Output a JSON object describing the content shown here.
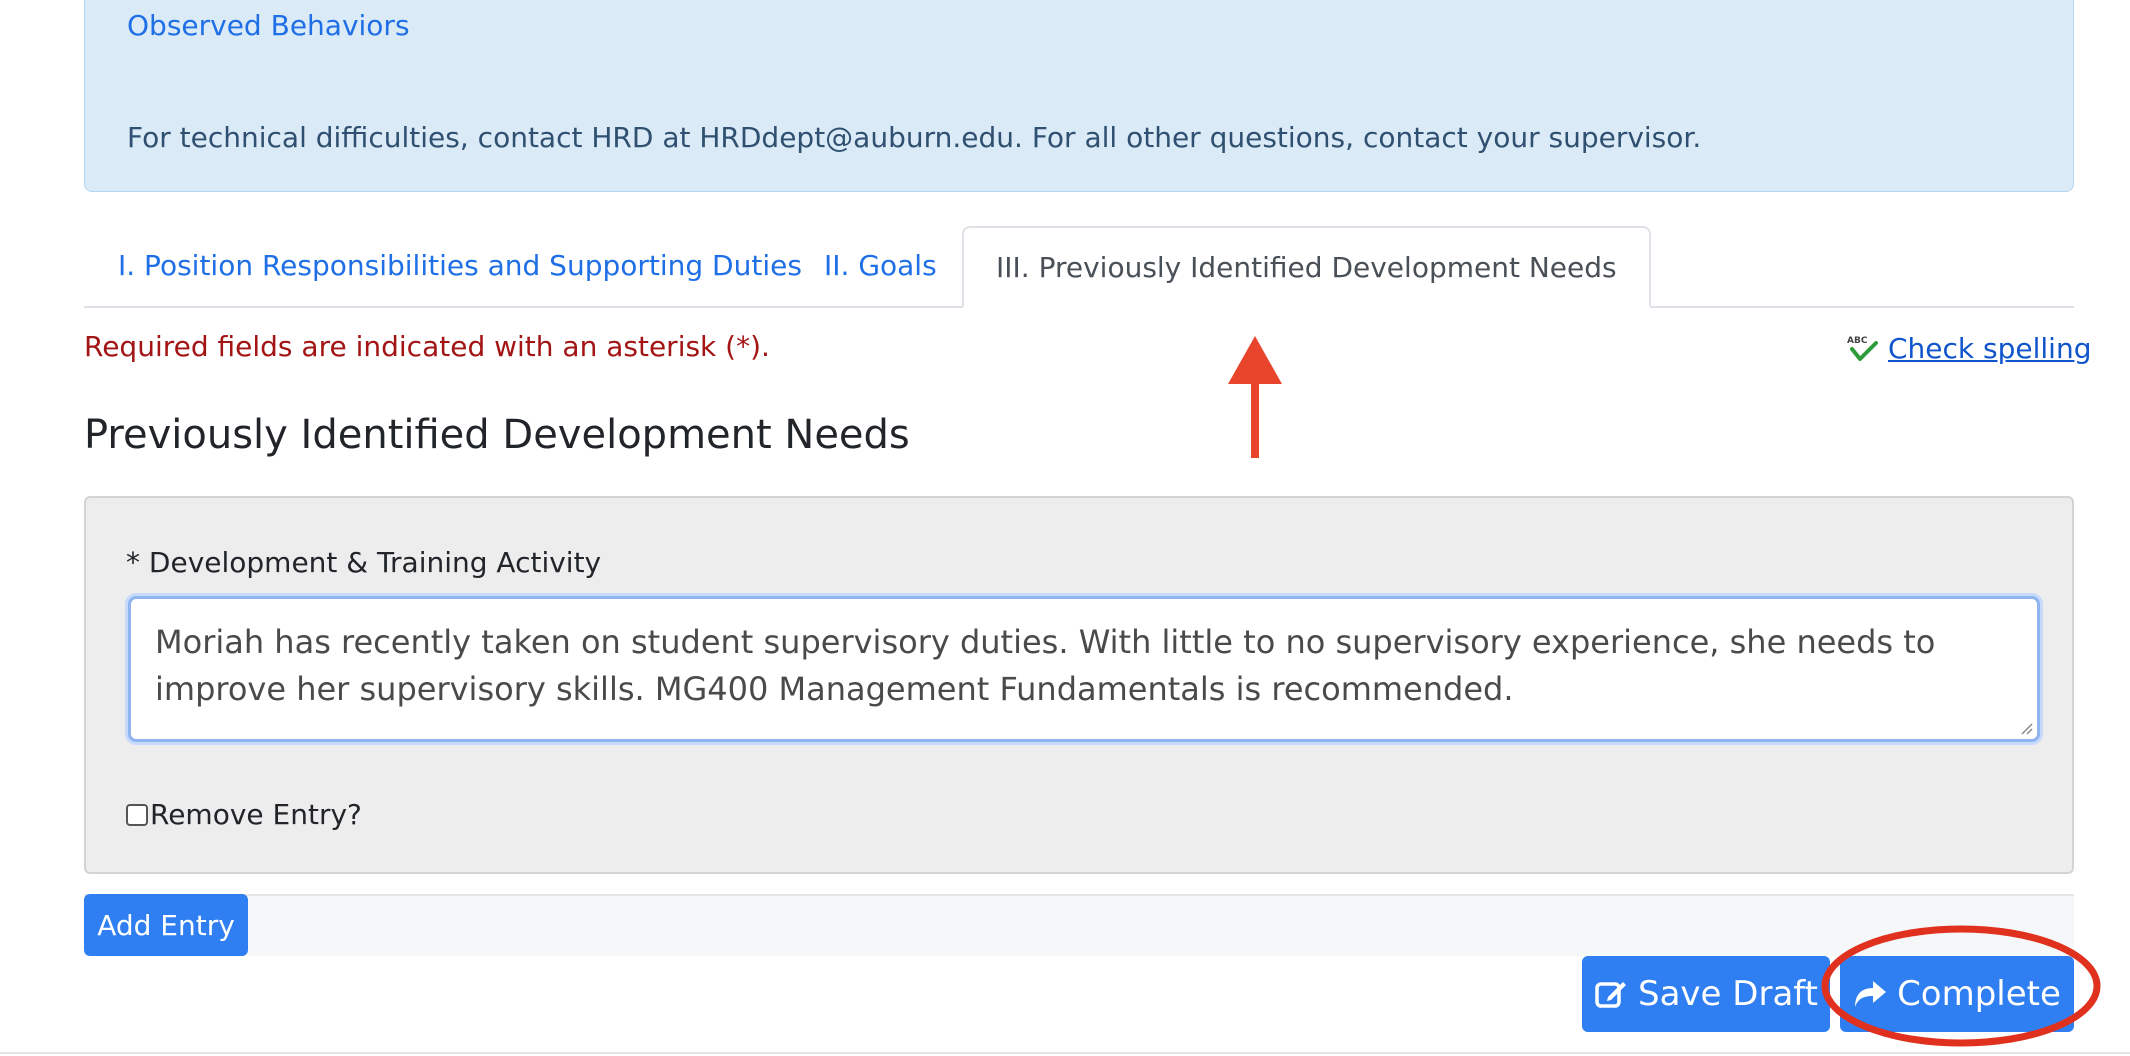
{
  "info": {
    "link_text": "Observed Behaviors",
    "contact_text": "For technical difficulties, contact HRD at HRDdept@auburn.edu. For all other questions, contact your supervisor."
  },
  "tabs": [
    {
      "label": "I. Position Responsibilities and Supporting Duties",
      "active": false
    },
    {
      "label": "II. Goals",
      "active": false
    },
    {
      "label": "III. Previously Identified Development Needs",
      "active": true
    }
  ],
  "required_note": "Required fields are indicated with an asterisk (*).",
  "spell_check": {
    "label": "Check spelling",
    "icon": "abc-spellcheck-icon"
  },
  "section": {
    "title": "Previously Identified Development Needs"
  },
  "entry": {
    "field_label": "* Development & Training Activity",
    "value": "Moriah has recently taken on student supervisory duties. With little to no supervisory experience, she needs to improve her supervisory skills. MG400 Management Fundamentals is recommended.",
    "remove_label": "Remove Entry?",
    "remove_checked": false
  },
  "buttons": {
    "add_entry": "Add Entry",
    "save_draft": "Save Draft",
    "complete": "Complete"
  },
  "annotations": {
    "arrow_color": "#e8452c",
    "circle_color": "#e0301e"
  },
  "colors": {
    "primary": "#2f7ff2",
    "link": "#1f6fe6",
    "required": "#a31515",
    "info_bg": "#dbeaf7"
  }
}
